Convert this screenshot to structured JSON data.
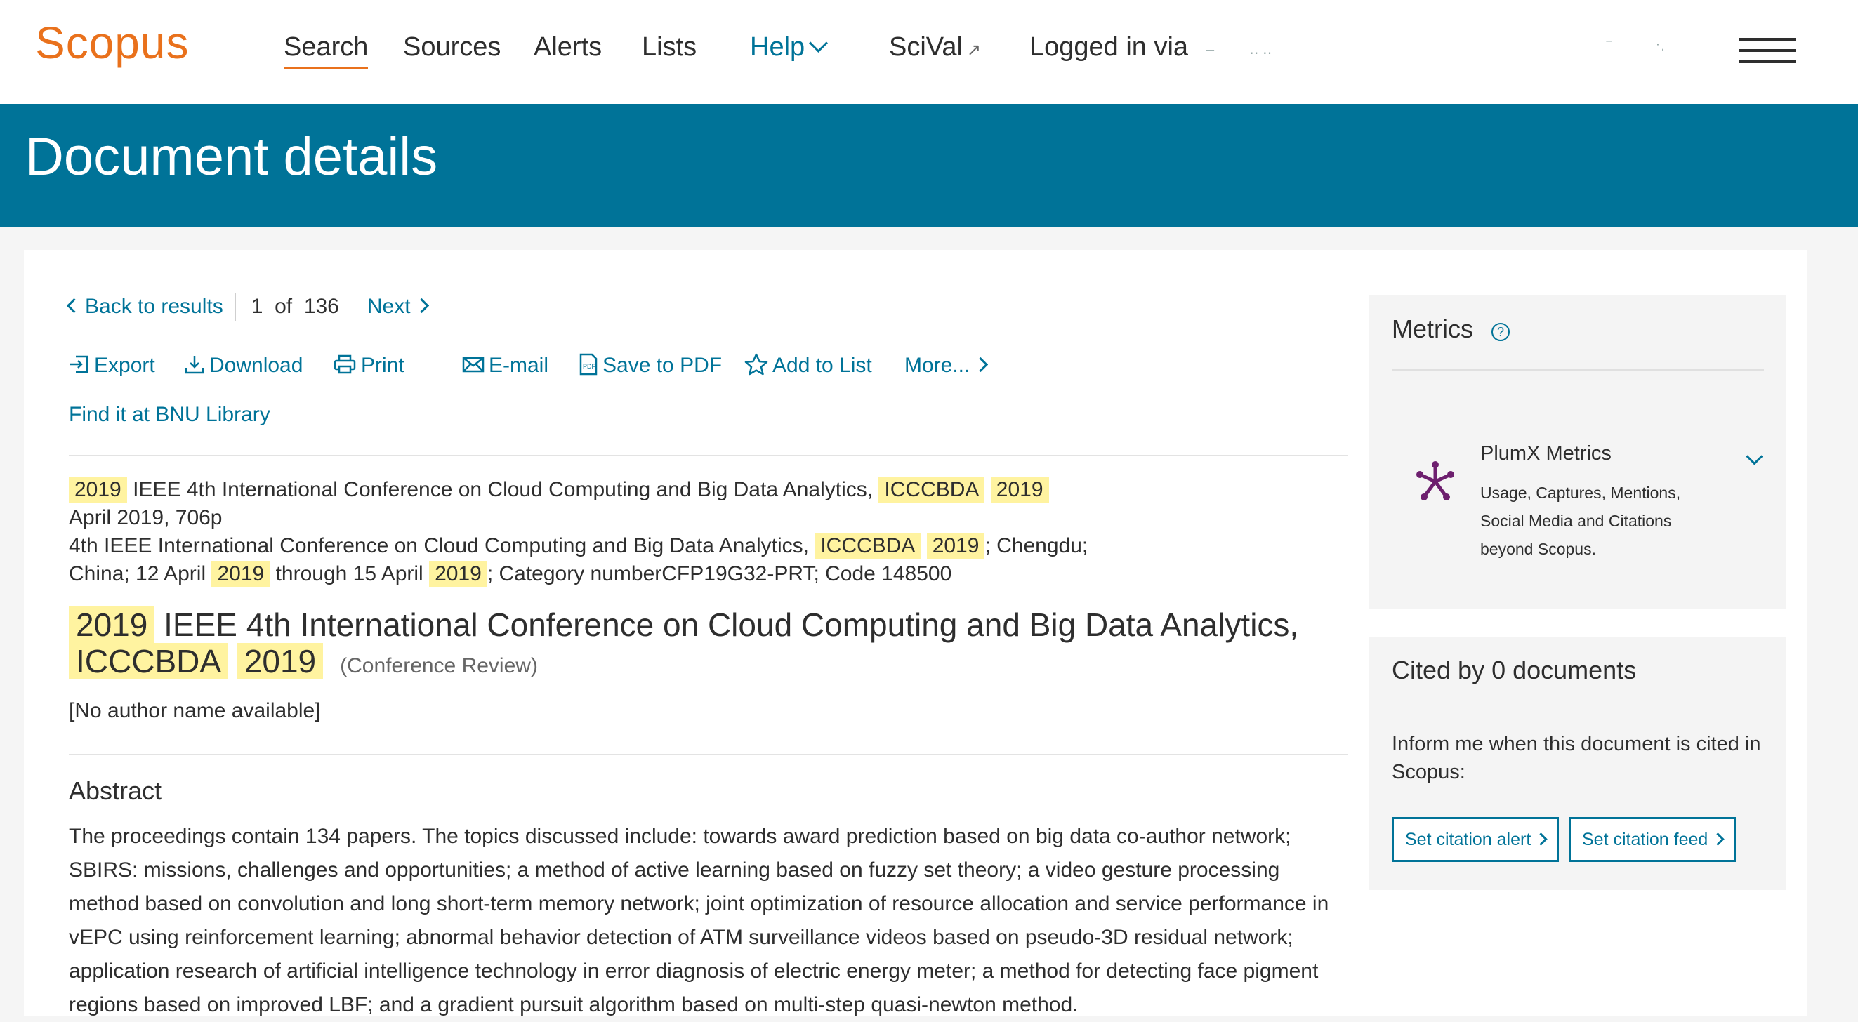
{
  "nav": {
    "brand": "Scopus",
    "items": [
      "Search",
      "Sources",
      "Alerts",
      "Lists"
    ],
    "help": "Help",
    "scival": "SciVal",
    "scival_icon": "external-link-icon",
    "logged_in": "Logged in via"
  },
  "banner": {
    "title": "Document details"
  },
  "crumbs": {
    "back": "Back to results",
    "position": "1",
    "of": "of",
    "total": "136",
    "next": "Next"
  },
  "actions": {
    "export": "Export",
    "download": "Download",
    "print": "Print",
    "email": "E-mail",
    "save_pdf": "Save to PDF",
    "add_list": "Add to List",
    "more": "More...",
    "find_it": "Find it at BNU Library"
  },
  "source": {
    "l1_year": "2019",
    "l1_text": "IEEE 4th International Conference on Cloud Computing and Big Data Analytics,",
    "l1_acr": "ICCCBDA",
    "l1_year2": "2019",
    "l2": "April 2019, 706p",
    "l3_text": "4th IEEE International Conference on Cloud Computing and Big Data Analytics,",
    "l3_acr": "ICCCBDA",
    "l3_year": "2019",
    "l3_tail": "; Chengdu;",
    "l4_a": "China; 12 April",
    "l4_year": "2019",
    "l4_b": "through 15 April",
    "l4_year2": "2019",
    "l4_tail": "; Category numberCFP19G32-PRT; Code 148500"
  },
  "document": {
    "title_year": "2019",
    "title_text": "IEEE 4th International Conference on Cloud Computing and Big Data Analytics,",
    "title_acr": "ICCCBDA",
    "title_year2": "2019",
    "doc_type": "(Conference Review)",
    "authors": "[No author name available]"
  },
  "abstract": {
    "heading": "Abstract",
    "text": "The proceedings contain 134 papers. The topics discussed include: towards award prediction based on big data co-author network; SBIRS: missions, challenges and opportunities; a method of active learning based on fuzzy set theory; a video gesture processing method based on convolution and long short-term memory network; joint optimization of resource allocation and service performance in vEPC using reinforcement learning; abnormal behavior detection of ATM surveillance videos based on pseudo-3D residual network; application research of artificial intelligence technology in error diagnosis of electric energy meter; a method for detecting face pigment regions based on improved LBF; and a gradient pursuit algorithm based on multi-step quasi-newton method."
  },
  "metrics": {
    "title": "Metrics",
    "help_glyph": "?",
    "plumx_title": "PlumX Metrics",
    "plumx_desc": "Usage, Captures, Mentions, Social Media and Citations beyond Scopus."
  },
  "cited": {
    "title": "Cited by 0 documents",
    "text": "Inform me when this document is cited in Scopus:",
    "alert_btn": "Set citation alert",
    "feed_btn": "Set citation feed"
  },
  "colors": {
    "brand": "#e9711c",
    "primary": "#007398",
    "highlight": "#fff3a0",
    "plumx": "#6d1f6e"
  }
}
